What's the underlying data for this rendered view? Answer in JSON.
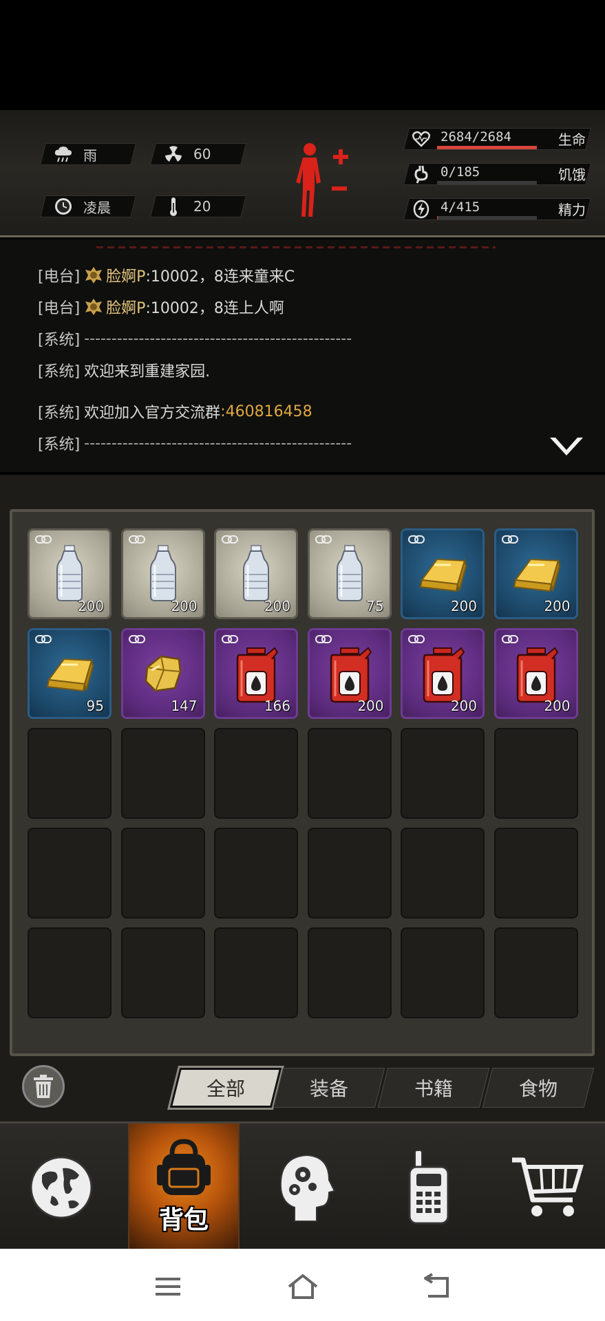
{
  "status": {
    "weather": {
      "icon": "rain-cloud-icon",
      "label": "雨"
    },
    "radiation": {
      "icon": "radiation-icon",
      "value": "60"
    },
    "time": {
      "icon": "clock-icon",
      "label": "凌晨"
    },
    "temperature": {
      "icon": "thermometer-icon",
      "value": "20"
    },
    "health": {
      "icon": "heart-icon",
      "value": "2684/2684",
      "label": "生命",
      "fill": 1.0
    },
    "hunger": {
      "icon": "stomach-icon",
      "value": "0/185",
      "label": "饥饿",
      "fill": 0.0
    },
    "energy": {
      "icon": "energy-icon",
      "value": "4/415",
      "label": "精力",
      "fill": 0.01
    }
  },
  "chat": {
    "lines": [
      {
        "channel": "[电台]",
        "name": "脸婀P",
        "text": ":10002，8连来童来C"
      },
      {
        "channel": "[电台]",
        "name": "脸婀P",
        "text": ":10002，8连上人啊"
      },
      {
        "channel": "[系统]",
        "text": "-------------------------------------------------"
      },
      {
        "channel": "[系统]",
        "text": "欢迎来到重建家园."
      },
      {
        "channel": "[系统]",
        "text": " 欢迎加入官方交流群",
        "highlight": ":460816458"
      },
      {
        "channel": "[系统]",
        "text": "-------------------------------------------------"
      }
    ]
  },
  "inventory": {
    "items": [
      {
        "type": "water-bottle",
        "rarity": "gray",
        "qty": "200"
      },
      {
        "type": "water-bottle",
        "rarity": "gray",
        "qty": "200"
      },
      {
        "type": "water-bottle",
        "rarity": "gray",
        "qty": "200"
      },
      {
        "type": "water-bottle",
        "rarity": "gray",
        "qty": "75"
      },
      {
        "type": "gold-bar",
        "rarity": "blue",
        "qty": "200"
      },
      {
        "type": "gold-bar",
        "rarity": "blue",
        "qty": "200"
      },
      {
        "type": "gold-bar",
        "rarity": "blue",
        "qty": "95"
      },
      {
        "type": "gold-ore",
        "rarity": "purple",
        "qty": "147"
      },
      {
        "type": "fuel-can",
        "rarity": "purple",
        "qty": "166"
      },
      {
        "type": "fuel-can",
        "rarity": "purple",
        "qty": "200"
      },
      {
        "type": "fuel-can",
        "rarity": "purple",
        "qty": "200"
      },
      {
        "type": "fuel-can",
        "rarity": "purple",
        "qty": "200"
      }
    ],
    "total_slots": 30
  },
  "filters": {
    "tabs": [
      "全部",
      "装备",
      "书籍",
      "食物"
    ],
    "active": "全部"
  },
  "nav": {
    "items": [
      {
        "id": "world",
        "icon": "globe-icon"
      },
      {
        "id": "backpack",
        "icon": "backpack-icon",
        "label": "背包",
        "active": true
      },
      {
        "id": "skills",
        "icon": "head-gears-icon"
      },
      {
        "id": "radio",
        "icon": "walkie-talkie-icon"
      },
      {
        "id": "shop",
        "icon": "shopping-cart-icon"
      }
    ]
  },
  "colors": {
    "gray_rarity": "#a9a595",
    "blue_rarity": "#1c4767",
    "purple_rarity": "#5b2b7c",
    "health_bar": "#d8453b",
    "highlight_text": "#e0a840"
  }
}
